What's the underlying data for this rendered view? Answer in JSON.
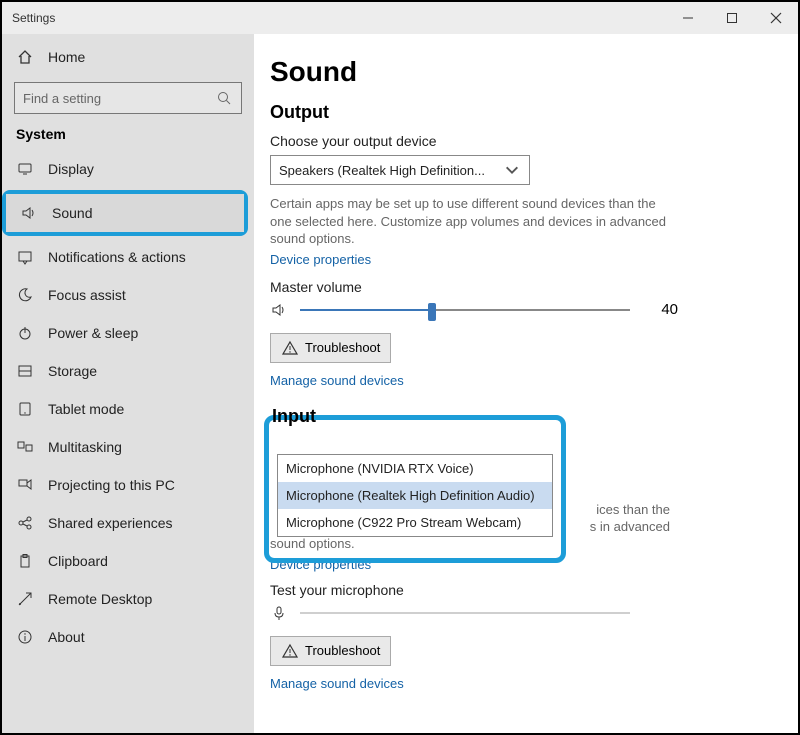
{
  "window": {
    "title": "Settings"
  },
  "sidebar": {
    "home": "Home",
    "search_placeholder": "Find a setting",
    "group": "System",
    "items": [
      {
        "label": "Display",
        "icon": "display"
      },
      {
        "label": "Sound",
        "icon": "sound"
      },
      {
        "label": "Notifications & actions",
        "icon": "notifications"
      },
      {
        "label": "Focus assist",
        "icon": "moon"
      },
      {
        "label": "Power & sleep",
        "icon": "power"
      },
      {
        "label": "Storage",
        "icon": "storage"
      },
      {
        "label": "Tablet mode",
        "icon": "tablet"
      },
      {
        "label": "Multitasking",
        "icon": "multitask"
      },
      {
        "label": "Projecting to this PC",
        "icon": "project"
      },
      {
        "label": "Shared experiences",
        "icon": "share"
      },
      {
        "label": "Clipboard",
        "icon": "clipboard"
      },
      {
        "label": "Remote Desktop",
        "icon": "remote"
      },
      {
        "label": "About",
        "icon": "about"
      }
    ],
    "highlight_index": 1
  },
  "page": {
    "title": "Sound",
    "output": {
      "heading": "Output",
      "choose_label": "Choose your output device",
      "selected": "Speakers (Realtek High Definition...",
      "hint": "Certain apps may be set up to use different sound devices than the one selected here. Customize app volumes and devices in advanced sound options.",
      "device_props": "Device properties",
      "master_volume_label": "Master volume",
      "volume": 40,
      "troubleshoot": "Troubleshoot",
      "manage": "Manage sound devices"
    },
    "input": {
      "heading": "Input",
      "options": [
        "Microphone (NVIDIA RTX Voice)",
        "Microphone (Realtek High Definition Audio)",
        "Microphone (C922 Pro Stream Webcam)"
      ],
      "selected_index": 1,
      "hint_tail_1": "ices than the",
      "hint_tail_2": "s in advanced",
      "hint_tail_3": "sound options.",
      "device_props": "Device properties",
      "test_label": "Test your microphone",
      "troubleshoot": "Troubleshoot",
      "manage": "Manage sound devices"
    }
  }
}
